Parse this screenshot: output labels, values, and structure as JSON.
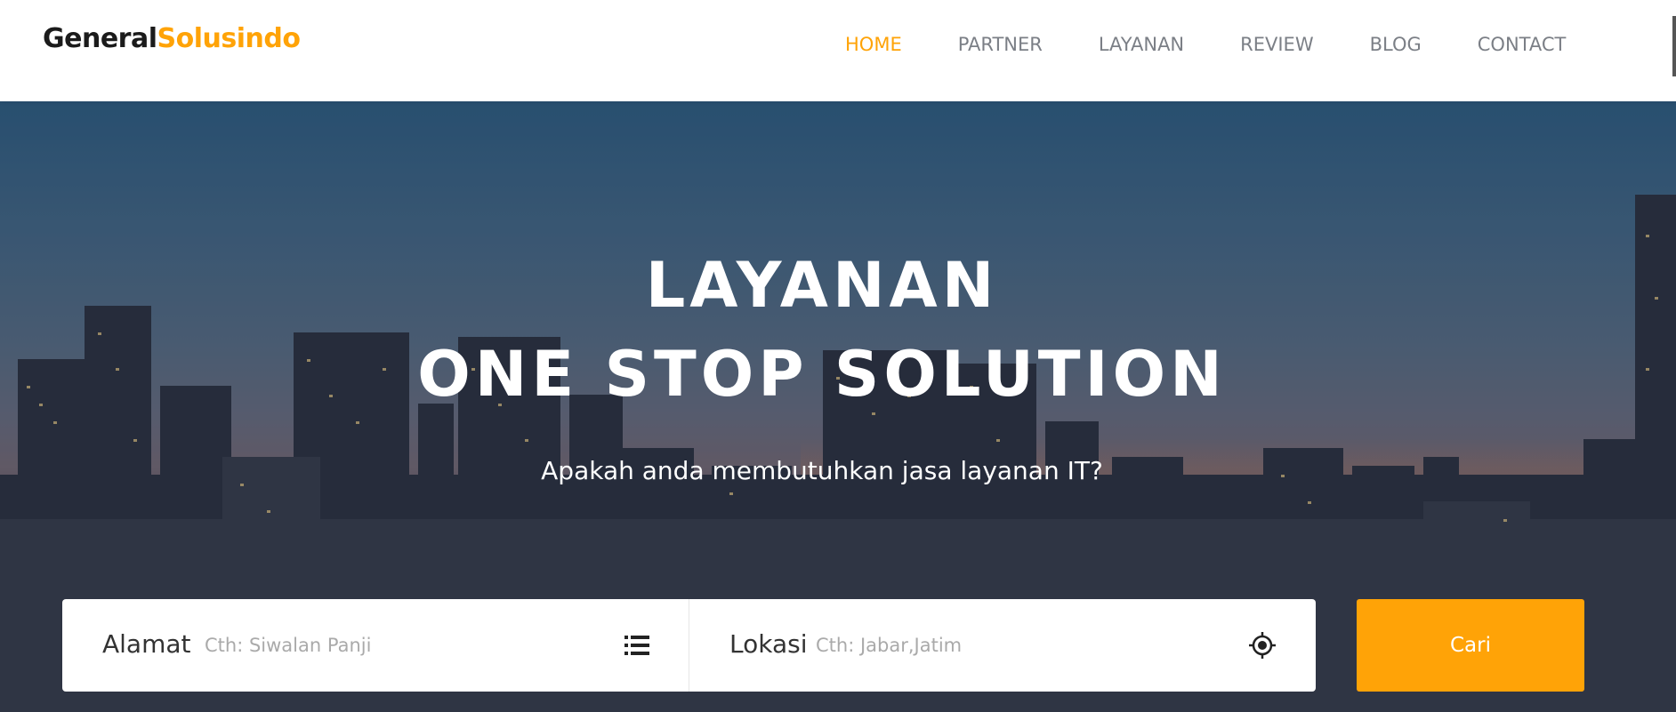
{
  "logo": {
    "part1": "General",
    "part2": "Solusindo"
  },
  "nav": {
    "items": [
      {
        "label": "HOME"
      },
      {
        "label": "PARTNER"
      },
      {
        "label": "LAYANAN"
      },
      {
        "label": "REVIEW"
      },
      {
        "label": "BLOG"
      },
      {
        "label": "CONTACT"
      }
    ],
    "active": "HOME"
  },
  "hero": {
    "title_line1": "LAYANAN",
    "title_line2": "ONE STOP SOLUTION",
    "subtitle": "Apakah anda membutuhkan jasa layanan IT?"
  },
  "search": {
    "address_label": "Alamat",
    "address_placeholder": "Cth: Siwalan Panji",
    "address_icon": "list-icon",
    "location_label": "Lokasi",
    "location_placeholder": "Cth: Jabar,Jatim",
    "location_icon": "crosshair-icon",
    "button_label": "Cari"
  },
  "colors": {
    "accent": "#ffa307",
    "nav_text": "#7b7f86",
    "dark_text": "#1b1b1b"
  }
}
